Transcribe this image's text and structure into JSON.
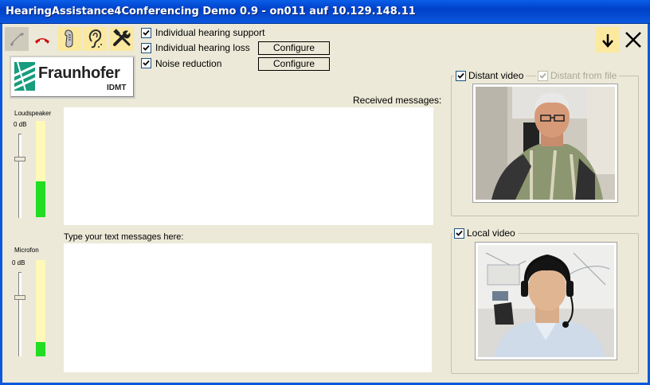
{
  "window": {
    "title": "HearingAssistance4Conferencing Demo 0.9 - on011 auf 10.129.148.11"
  },
  "toolbar": {
    "buttons": [
      {
        "name": "phone-pickup-icon"
      },
      {
        "name": "phone-hangup-icon"
      },
      {
        "name": "hearing-aid-icon"
      },
      {
        "name": "ear-icon"
      },
      {
        "name": "tools-icon"
      }
    ],
    "minimize_icon": "arrow-down-icon",
    "close_icon": "close-icon"
  },
  "options": [
    {
      "label": "Individual hearing support",
      "checked": true
    },
    {
      "label": "Individual hearing loss",
      "checked": true,
      "button": "Configure"
    },
    {
      "label": "Noise reduction",
      "checked": true,
      "button": "Configure"
    }
  ],
  "logo": {
    "name": "Fraunhofer",
    "sub": "IDMT"
  },
  "loudspeaker": {
    "label": "Loudspeaker",
    "db": "0 dB",
    "level": 0.37,
    "slider": 0.3
  },
  "microfon": {
    "label": "Microfon",
    "db": "0 dB",
    "level": 0.15,
    "slider": 0.3
  },
  "messages": {
    "received_label": "Received messages:",
    "type_label": "Type your text messages here:"
  },
  "distant_video": {
    "label": "Distant video",
    "checked": true,
    "from_file_label": "Distant from file",
    "from_file_checked": true
  },
  "local_video": {
    "label": "Local video",
    "checked": true
  },
  "colors": {
    "titlebar": "#0b58de",
    "meter_bg": "#fff9b8",
    "meter_fill": "#22dd22",
    "window_bg": "#ece9d8"
  }
}
